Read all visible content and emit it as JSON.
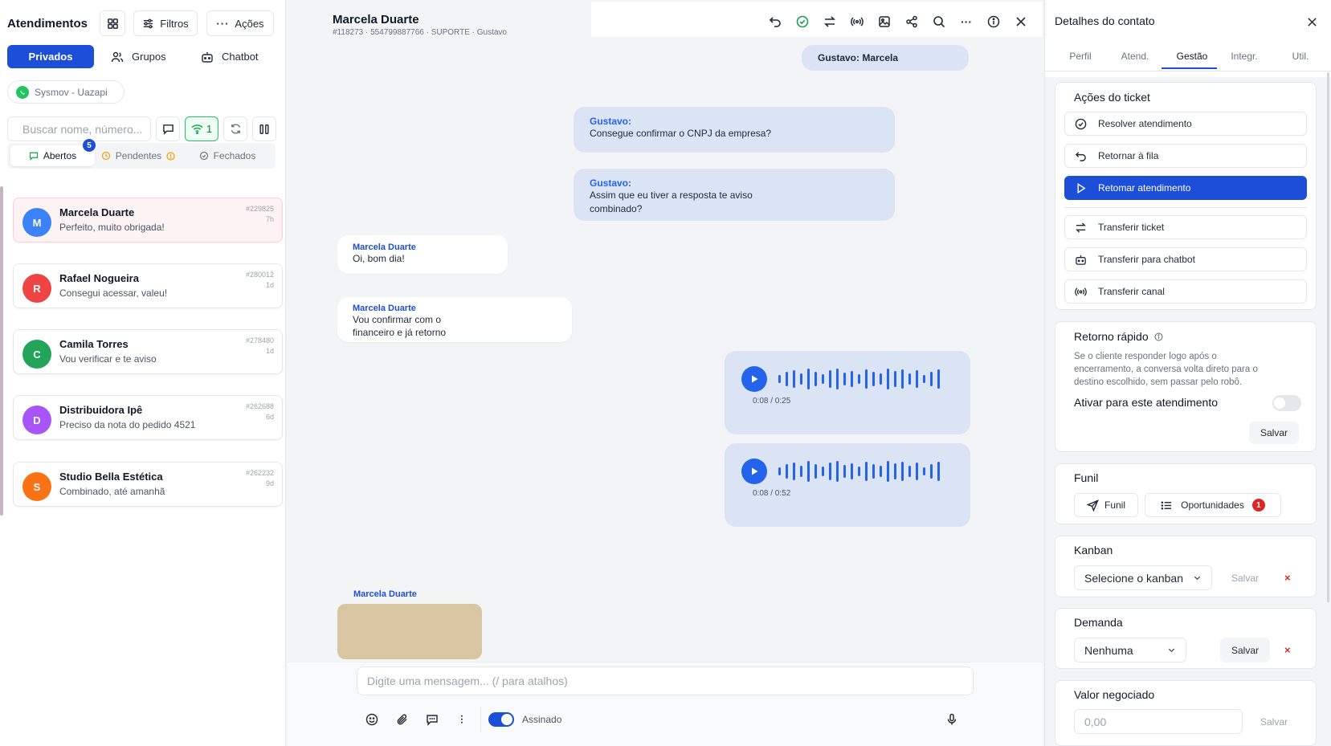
{
  "left": {
    "title": "Atendimentos",
    "filters_label": "Filtros",
    "actions_label": "Ações",
    "tabs": [
      {
        "label": "Privados"
      },
      {
        "label": "Grupos"
      },
      {
        "label": "Chatbot"
      }
    ],
    "channel": "Sysmov - Uazapi",
    "search_placeholder": "Buscar nome, número...",
    "connection_count": "1",
    "status_tabs": [
      {
        "label": "Abertos",
        "badge": "5"
      },
      {
        "label": "Pendentes"
      },
      {
        "label": "Fechados"
      }
    ],
    "conversations": [
      {
        "initial": "M",
        "name": "Marcela Duarte",
        "preview": "Perfeito, muito obrigada!",
        "id": "#229825",
        "time": "7h",
        "color": "#3b82f6"
      },
      {
        "initial": "R",
        "name": "Rafael Nogueira",
        "preview": "Consegui acessar, valeu!",
        "id": "#280012",
        "time": "1d",
        "color": "#ef4444"
      },
      {
        "initial": "C",
        "name": "Camila Torres",
        "preview": "Vou verificar e te aviso",
        "id": "#278480",
        "time": "1d",
        "color": "#22a55b"
      },
      {
        "initial": "D",
        "name": "Distribuidora Ipê",
        "preview": "Preciso da nota do pedido 4521",
        "id": "#262688",
        "time": "6d",
        "color": "#a855f7"
      },
      {
        "initial": "S",
        "name": "Studio Bella Estética",
        "preview": "Combinado, até amanhã",
        "id": "#262232",
        "time": "9d",
        "color": "#f97316"
      }
    ]
  },
  "chat": {
    "contact_name": "Marcela Duarte",
    "contact_meta": "#118273 · 554799887766 · SUPORTE · Gustavo",
    "messages": {
      "m1": {
        "text": "Gustavo: Marcela"
      },
      "m2": {
        "author": "Gustavo:",
        "text": "Consegue confirmar o CNPJ da empresa?"
      },
      "m3": {
        "author": "Gustavo:",
        "line1": "Assim que eu tiver a resposta te aviso",
        "line2": "combinado?"
      },
      "m4": {
        "author": "Marcela Duarte",
        "text": "Oi, bom dia!"
      },
      "m5": {
        "author": "Marcela Duarte",
        "line1": "Vou confirmar com o",
        "line2": "financeiro e já retorno"
      },
      "a1": {
        "time": "0:08 / 0:25"
      },
      "a2": {
        "time": "0:08 / 0:52"
      },
      "m6": {
        "author": "Marcela Duarte"
      }
    },
    "composer_placeholder": "Digite uma mensagem... (/ para atalhos)",
    "signed_label": "Assinado",
    "signed_on": true
  },
  "right": {
    "title": "Detalhes do contato",
    "tabs": [
      {
        "label": "Perfil"
      },
      {
        "label": "Atend."
      },
      {
        "label": "Gestão"
      },
      {
        "label": "Integr."
      },
      {
        "label": "Util."
      }
    ],
    "active_tab": "Gestão",
    "ticket_actions_title": "Ações do ticket",
    "actions": [
      {
        "label": "Resolver atendimento"
      },
      {
        "label": "Retornar à fila"
      },
      {
        "label": "Retomar atendimento"
      },
      {
        "label": "Transferir ticket"
      },
      {
        "label": "Transferir para chatbot"
      },
      {
        "label": "Transferir canal"
      }
    ],
    "quick_return": {
      "title": "Retorno rápido",
      "line1": "Se o cliente responder logo após o",
      "line2": "encerramento, a conversa volta direto para o",
      "line3": "destino escolhido, sem passar pelo robô.",
      "toggle_label": "Ativar para este atendimento",
      "enabled": false,
      "save": "Salvar"
    },
    "funil": {
      "title": "Funil",
      "funil_button": "Funil",
      "opportunities_button": "Oportunidades",
      "opportunities_count": "1"
    },
    "kanban": {
      "title": "Kanban",
      "placeholder": "Selecione o kanban",
      "save": "Salvar"
    },
    "demanda": {
      "title": "Demanda",
      "value": "Nenhuma",
      "save": "Salvar"
    },
    "valor": {
      "title": "Valor negociado",
      "placeholder": "0,00",
      "save": "Salvar"
    }
  },
  "colors": {
    "primary": "#1d4ed8",
    "outgoing_bubble": "#dbe4f5",
    "danger": "#dc2626",
    "whatsapp": "#22c55e"
  }
}
